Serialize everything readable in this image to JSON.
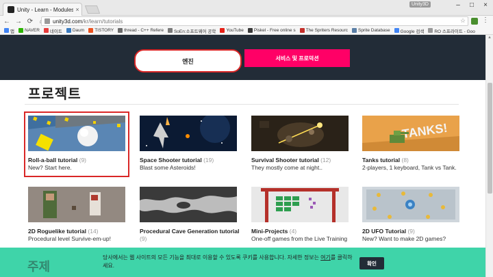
{
  "browser": {
    "tab_title": "Unity - Learn - Modules",
    "tab_close": "×",
    "window_label": "Unity3D",
    "window_controls": [
      "–",
      "□",
      "×"
    ],
    "nav": {
      "back": "←",
      "forward": "→",
      "reload": "⟳",
      "home": "⌂"
    },
    "url_host": "unity3d.com",
    "url_path": "/kr/learn/tutorials",
    "bookmark_star": "☆",
    "menu_icon": "⋮",
    "bookmarks": [
      {
        "label": "앱",
        "color": "#4285f4"
      },
      {
        "label": "NAVER",
        "color": "#2db400"
      },
      {
        "label": "네이트",
        "color": "#e63c3c"
      },
      {
        "label": "Daum",
        "color": "#3b7bbf"
      },
      {
        "label": "TISTORY",
        "color": "#eb531f"
      },
      {
        "label": "thread - C++ Refere",
        "color": "#6b6b6b"
      },
      {
        "label": "SoEn:소프트웨어 공학",
        "color": "#7a7a7a"
      },
      {
        "label": "YouTube",
        "color": "#e62117"
      },
      {
        "label": "Piskel - Free online s",
        "color": "#3a3a3a"
      },
      {
        "label": "The Spriters Resourc",
        "color": "#c4302b"
      },
      {
        "label": "Sprite Database",
        "color": "#5b7fa6"
      },
      {
        "label": "Google 검색",
        "color": "#4285f4"
      },
      {
        "label": "RO 스프라이트 - Goo",
        "color": "#999999"
      }
    ]
  },
  "tabs": {
    "engine_label": "엔진",
    "services_label": "서비스 및 프로덕션"
  },
  "section": {
    "title": "프로젝트"
  },
  "cards": [
    {
      "title": "Roll-a-ball tutorial",
      "count": "(9)",
      "desc": "New? Start here."
    },
    {
      "title": "Space Shooter tutorial",
      "count": "(19)",
      "desc": "Blast some Asteroids!"
    },
    {
      "title": "Survival Shooter tutorial",
      "count": "(12)",
      "desc": "They mostly come at night.."
    },
    {
      "title": "Tanks tutorial",
      "count": "(8)",
      "desc": "2-players, 1 keyboard, Tank vs Tank."
    },
    {
      "title": "2D Roguelike tutorial",
      "count": "(14)",
      "desc": "Procedural level Survive-em-up!"
    },
    {
      "title": "Procedural Cave Generation tutorial",
      "count": "(9)",
      "desc": ""
    },
    {
      "title": "Mini-Projects",
      "count": "(4)",
      "desc": "One-off games from the Live Training"
    },
    {
      "title": "2D UFO Tutorial",
      "count": "(9)",
      "desc": "New? Want to make 2D games?"
    }
  ],
  "tanks_thumb_text": "TANKS!",
  "cookie": {
    "text_before": "당사에서는 웹 사이트의 모든 기능을 최대로 이용할 수 있도록 쿠키를 사용합니다. 자세한 정보는 ",
    "link_text": "여기",
    "text_after": "를 클릭하세요.",
    "button_label": "확인"
  },
  "background_heading": "주제",
  "colors": {
    "header_dark": "#222c37",
    "accent_pink": "#ff0066",
    "cookie_green": "#3fd4a9",
    "highlight_red": "#d92626"
  }
}
